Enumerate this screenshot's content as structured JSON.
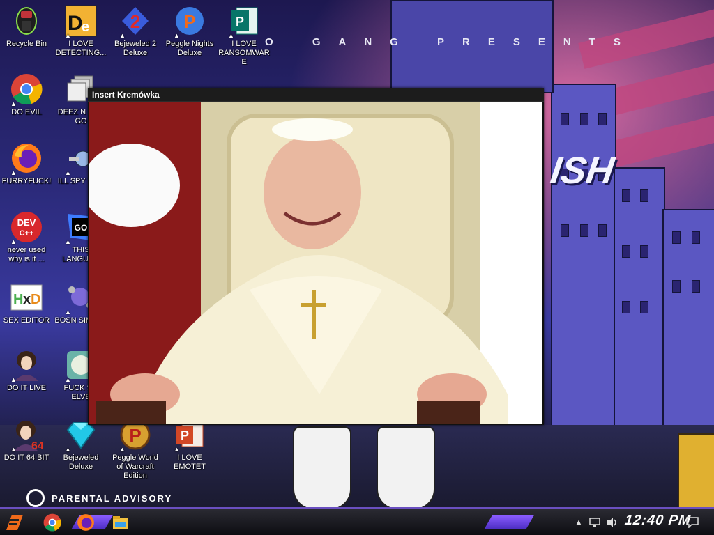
{
  "window": {
    "title": "Insert Kremówka"
  },
  "wallpaper": {
    "presents_text": "O GANG  PRESENTS",
    "ish_text": "ISH",
    "advisory_text": "PARENTAL ADVISORY"
  },
  "desktop": {
    "icons": [
      {
        "label": "Recycle Bin",
        "icon": "recycle-bin-icon"
      },
      {
        "label": "I LOVE DETECTING...",
        "icon": "detect-it-easy-icon"
      },
      {
        "label": "Bejeweled 2 Deluxe",
        "icon": "bejeweled-2-icon"
      },
      {
        "label": "Peggle Nights Deluxe",
        "icon": "peggle-nights-icon"
      },
      {
        "label": "I LOVE RANSOMWARE",
        "icon": "publisher-icon"
      },
      {
        "label": "DO EVIL",
        "icon": "chrome-icon"
      },
      {
        "label": "DEEZ N HAH GO",
        "icon": "stack-icon"
      },
      {
        "label": "FURRYFUCK!",
        "icon": "firefox-icon"
      },
      {
        "label": "ILL SPY YOU",
        "icon": "spy-icon"
      },
      {
        "label": "never used why is it ...",
        "icon": "dev-cpp-icon"
      },
      {
        "label": "THIS LANGUAG",
        "icon": "goland-icon"
      },
      {
        "label": "SEX EDITOR",
        "icon": "hxd-icon"
      },
      {
        "label": "BOSN SIMULA",
        "icon": "molecule-icon"
      },
      {
        "label": "DO IT LIVE",
        "icon": "portrait-icon"
      },
      {
        "label": "FUCK SO ELVE",
        "icon": "globe-icon"
      },
      {
        "label": "DO IT 64 BIT",
        "icon": "portrait-64-icon"
      },
      {
        "label": "Bejeweled Deluxe",
        "icon": "diamond-icon"
      },
      {
        "label": "Peggle World of Warcraft Edition",
        "icon": "peggle-wow-icon"
      },
      {
        "label": "I LOVE EMOTET",
        "icon": "powerpoint-icon"
      }
    ]
  },
  "taskbar": {
    "clock": "12:40 PM",
    "items": [
      "start-menu-icon",
      "chrome-icon",
      "firefox-icon",
      "file-explorer-icon"
    ]
  },
  "colors": {
    "accent": "#6a4fc0",
    "taskbar": "#111118"
  }
}
